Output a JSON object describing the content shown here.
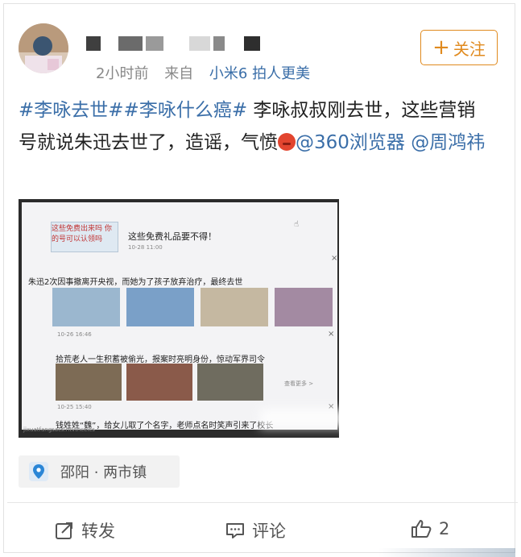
{
  "post": {
    "meta": {
      "time": "2小时前",
      "source_prefix": "来自",
      "device": "小米6 拍人更美"
    },
    "follow_button": {
      "label": "关注"
    },
    "text": {
      "tag1": "#李咏去世#",
      "tag2": "#李咏什么癌#",
      "body": " 李咏叔叔刚去世，这些营销号就说朱迅去世了，造谣，气愤",
      "mention1": "@360浏览器",
      "mention2": "@周鸿祎"
    },
    "photo_screen": {
      "banner_text": "这些免费出来吗 你的号可以认领吗",
      "top_title": "这些免费礼品要不得！",
      "top_date": "10-28 11:00",
      "article1_title": "朱迅2次因事撤离开央视，而她为了孩子放弃治疗，最终去世",
      "article1_date": "10-26 16:46",
      "article2_title": "拾荒老人一生积蓄被偷光，报案时亮明身份，惊动军界司令",
      "article2_date": "10-25 15:40",
      "article2_more": "查看更多 >",
      "article3_title": "钱姓姓“魏”，给女儿取了个名字，老师点名时笑声引来了校长",
      "footer_url": "jixuatfangsacs.htvtncelcs"
    },
    "location": {
      "label": "邵阳 · 两市镇"
    },
    "actions": {
      "repost": "转发",
      "comment": "评论",
      "like_count": "2"
    }
  },
  "colors": {
    "link": "#3a6ea8",
    "follow": "#e08a1e",
    "meta": "#888888"
  },
  "icons": [
    "plus-icon",
    "location-pin-icon",
    "repost-icon",
    "comment-icon",
    "like-icon",
    "angry-emoji-icon"
  ]
}
